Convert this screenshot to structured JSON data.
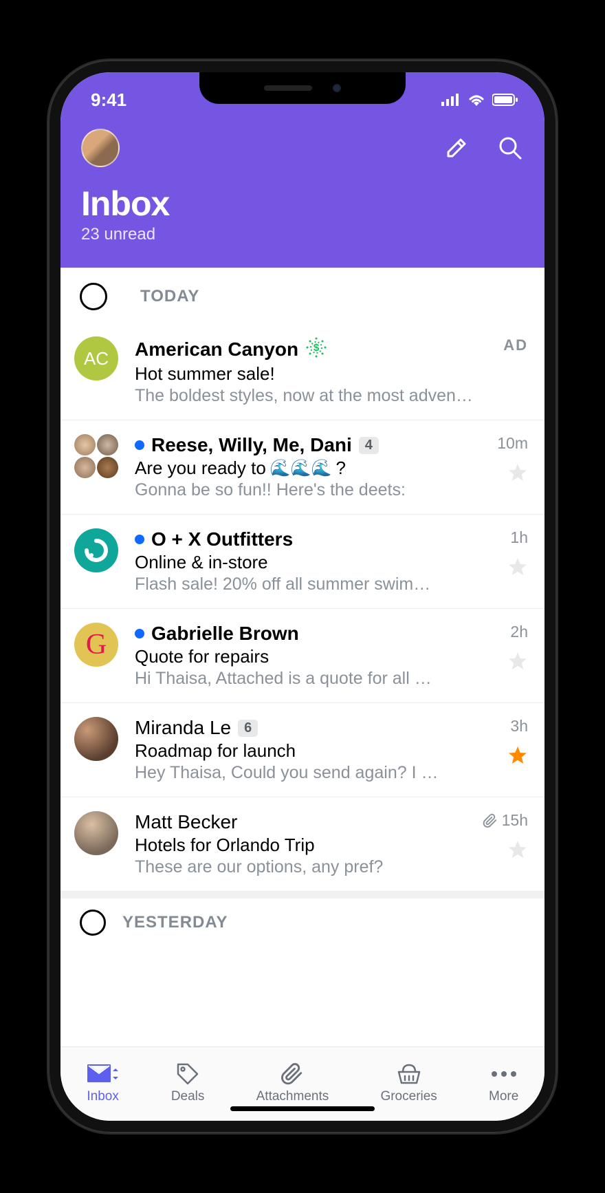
{
  "status": {
    "time": "9:41"
  },
  "header": {
    "title": "Inbox",
    "subtitle": "23 unread"
  },
  "sections": {
    "today": "TODAY",
    "yesterday": "YESTERDAY"
  },
  "ad": {
    "avatar_text": "AC",
    "sender": "American Canyon",
    "subject": "Hot summer sale!",
    "preview": "The boldest styles, now at the most adven…",
    "label": "AD"
  },
  "rows": [
    {
      "sender": "Reese, Willy, Me, Dani",
      "count": "4",
      "subject_pre": "Are you ready to ",
      "subject_post": "?",
      "emoji": "🌊🌊🌊",
      "preview": "Gonna be so fun!! Here's the deets:",
      "time": "10m",
      "unread": true,
      "starred": false
    },
    {
      "sender": "O + X Outfitters",
      "subject": "Online & in-store",
      "preview": "Flash sale! 20% off all summer swim…",
      "time": "1h",
      "unread": true,
      "starred": false
    },
    {
      "sender": "Gabrielle Brown",
      "subject": "Quote for repairs",
      "preview": "Hi Thaisa, Attached is a quote for all …",
      "time": "2h",
      "unread": true,
      "starred": false
    },
    {
      "sender": "Miranda Le",
      "count": "6",
      "subject": "Roadmap for launch",
      "preview": "Hey Thaisa, Could you send again? I …",
      "time": "3h",
      "unread": false,
      "starred": true
    },
    {
      "sender": "Matt Becker",
      "subject": "Hotels for Orlando Trip",
      "preview": "These are our options, any pref?",
      "time": "15h",
      "unread": false,
      "starred": false,
      "attachment": true
    }
  ],
  "nav": {
    "inbox": "Inbox",
    "deals": "Deals",
    "attachments": "Attachments",
    "groceries": "Groceries",
    "more": "More"
  }
}
